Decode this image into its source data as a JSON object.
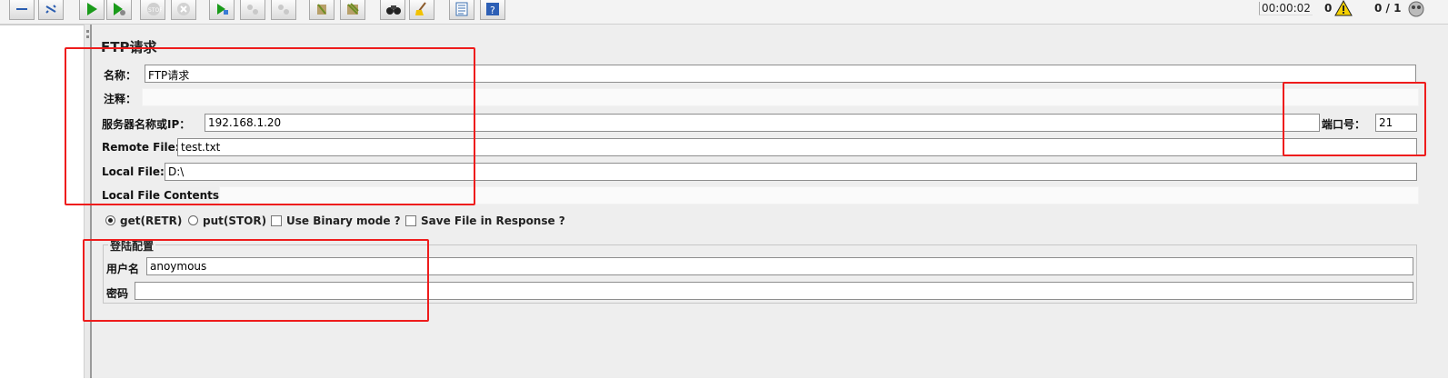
{
  "toolbar": {
    "timer": "00:00:02",
    "error_count": "0",
    "threads": "0 / 1",
    "icons": [
      "collapse-icon",
      "toggle-icon",
      "start-icon",
      "start-no-pause-icon",
      "stop-icon",
      "shutdown-icon",
      "remote-start-icon",
      "remote-stop-icon",
      "remote-shutdown-icon",
      "clear-icon",
      "clear-all-icon",
      "search-icon",
      "reset-search-icon",
      "function-helper-icon",
      "help-icon"
    ],
    "accent_color": "#1a9b1a"
  },
  "panel": {
    "title": "FTP请求",
    "name_label": "名称：",
    "name_value": "FTP请求",
    "comment_label": "注释：",
    "comment_value": "",
    "server_label": "服务器名称或IP：",
    "server_value": "192.168.1.20",
    "port_label": "端口号：",
    "port_value": "21",
    "remote_file_label": "Remote File:",
    "remote_file_value": "test.txt",
    "local_file_label": "Local File:",
    "local_file_value": "D:\\",
    "local_contents_label": "Local File Contents:",
    "local_contents_value": ""
  },
  "options": {
    "get_label": "get(RETR)",
    "get_selected": true,
    "put_label": "put(STOR)",
    "put_selected": false,
    "binary_label": "Use Binary mode ?",
    "binary_checked": false,
    "save_label": "Save File in Response ?",
    "save_checked": false
  },
  "login": {
    "group_title": "登陆配置",
    "username_label": "用户名",
    "username_value": "anoymous",
    "password_label": "密码",
    "password_value": ""
  },
  "annotation_color": "#ee1c1c"
}
